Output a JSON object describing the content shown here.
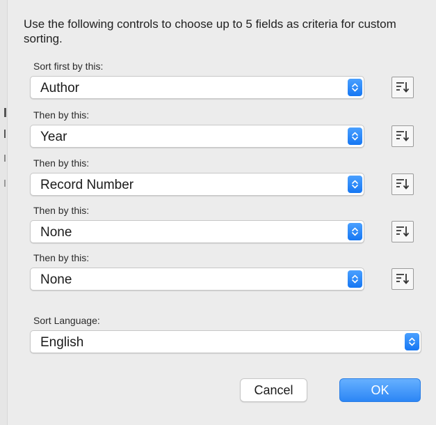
{
  "dialog": {
    "intro": "Use the following controls to choose up to 5 fields as criteria for custom sorting."
  },
  "sort_rows": [
    {
      "label": "Sort first by this:",
      "value": "Author"
    },
    {
      "label": "Then by this:",
      "value": "Year"
    },
    {
      "label": "Then by this:",
      "value": "Record Number"
    },
    {
      "label": "Then by this:",
      "value": "None"
    },
    {
      "label": "Then by this:",
      "value": "None"
    }
  ],
  "language": {
    "label": "Sort Language:",
    "value": "English"
  },
  "buttons": {
    "cancel": "Cancel",
    "ok": "OK"
  },
  "icons": {
    "stepper": "up-down-chevron-icon",
    "sort_order": "sort-descending-icon"
  },
  "colors": {
    "accent": "#2c86f5",
    "background": "#ececec"
  }
}
